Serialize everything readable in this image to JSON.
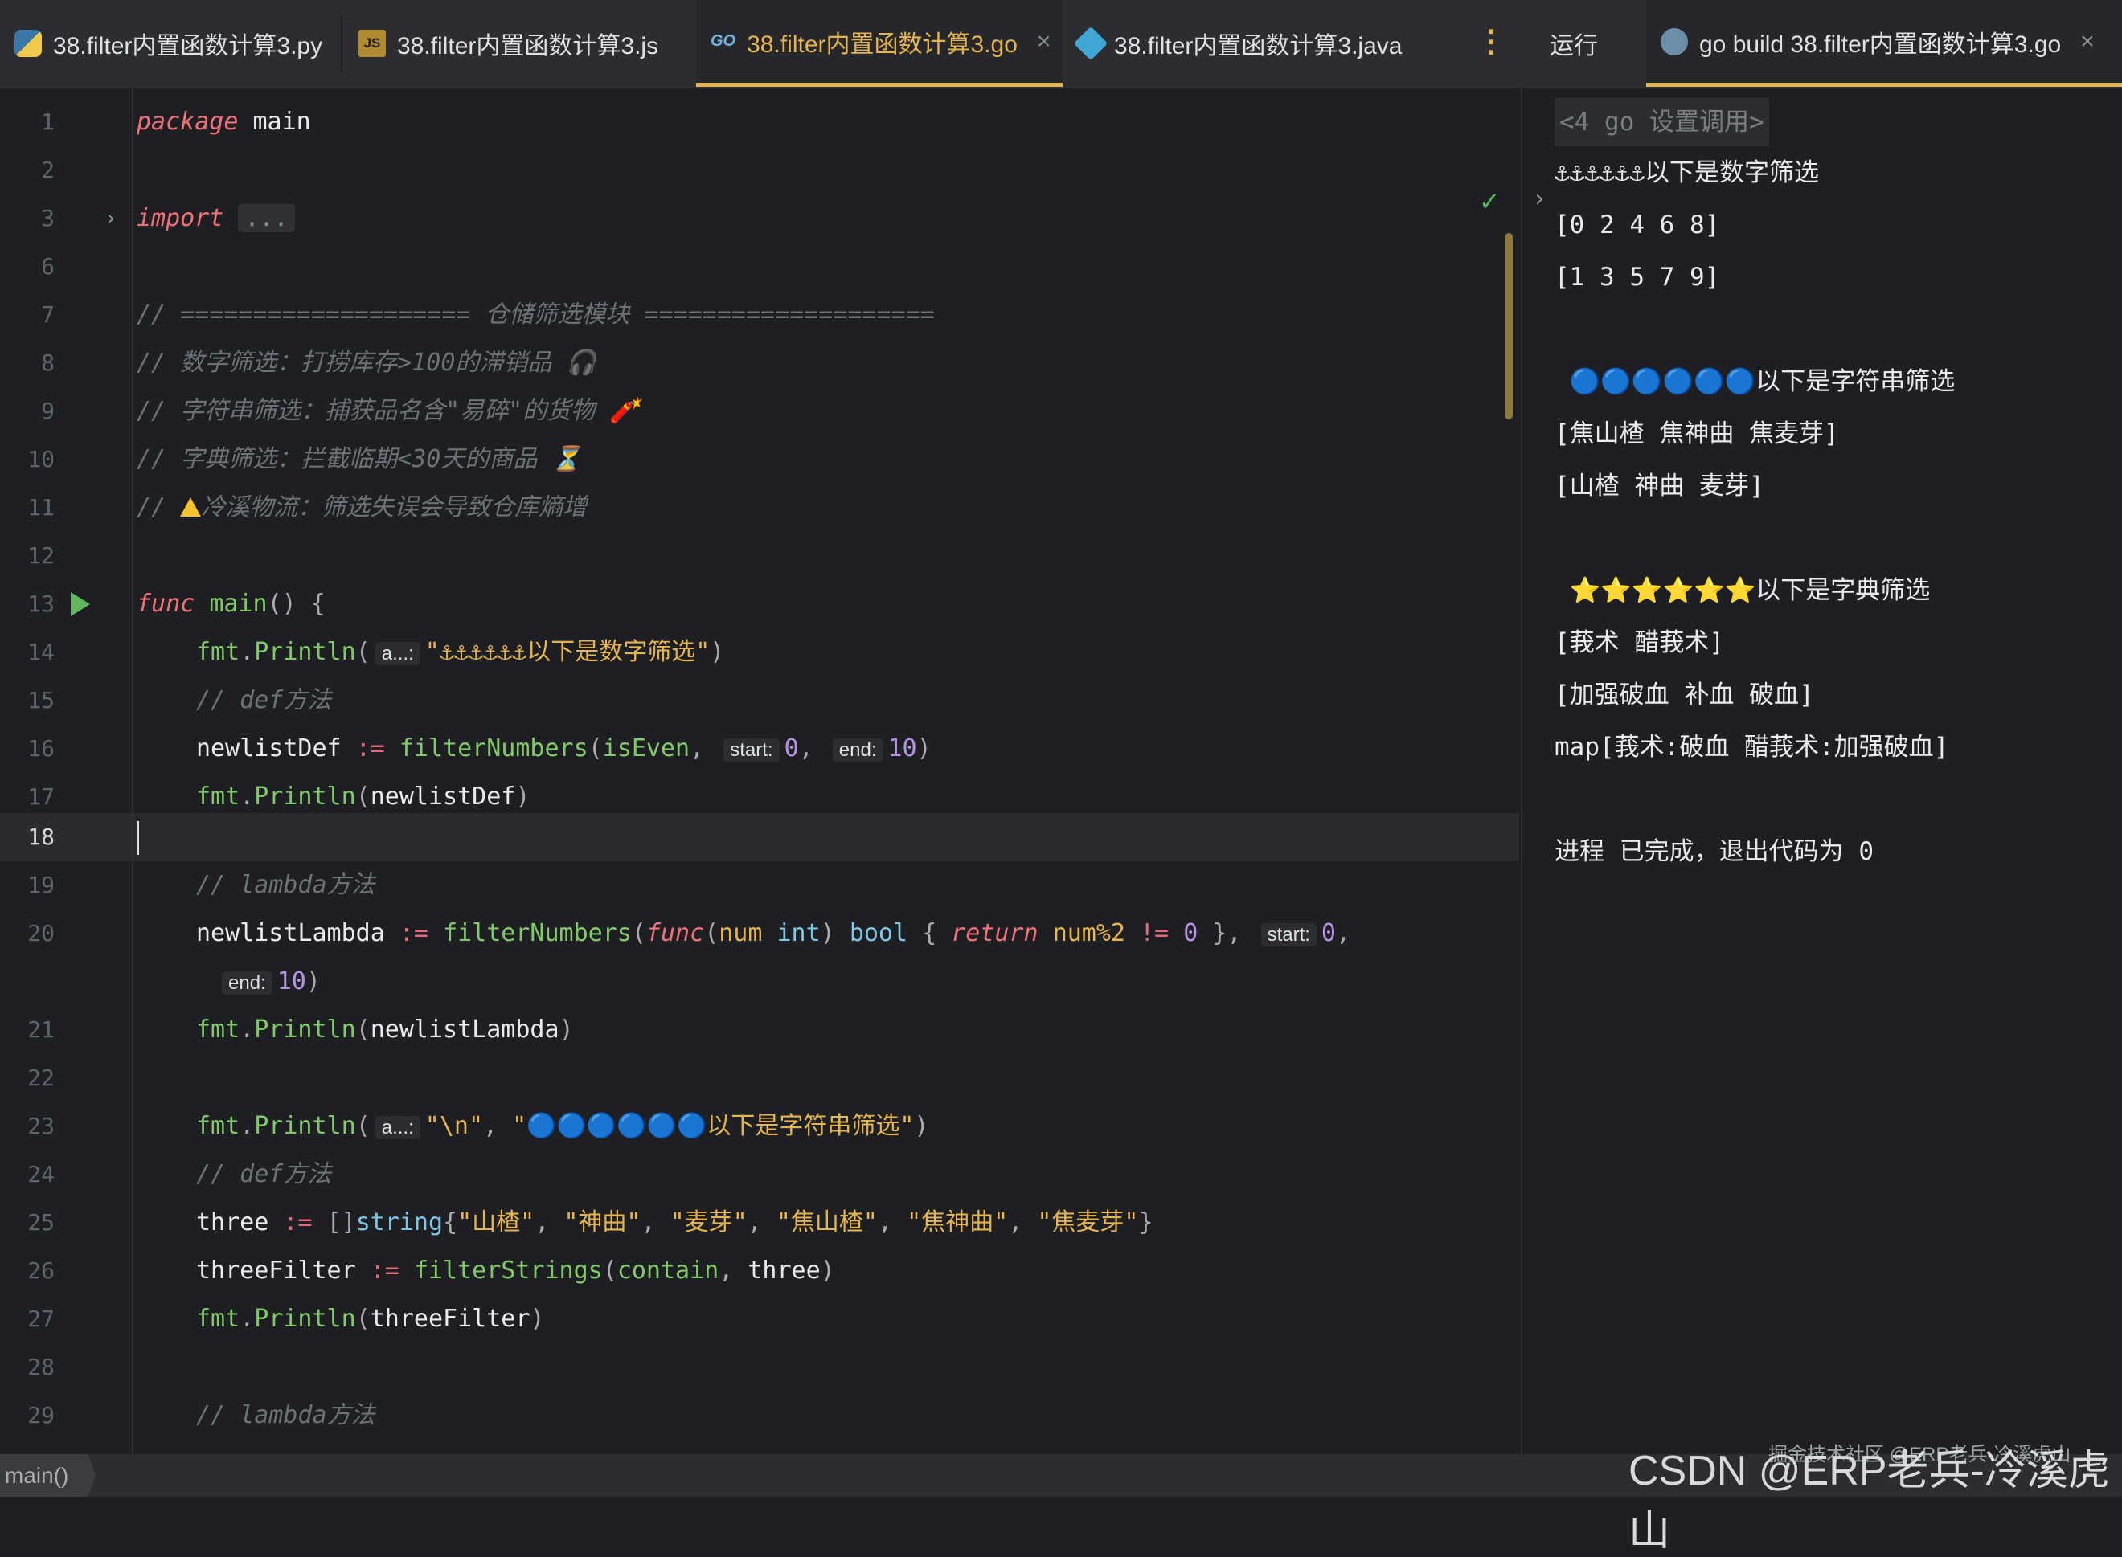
{
  "tabs": [
    {
      "label": "38.filter内置函数计算3.py",
      "icon": "python-icon"
    },
    {
      "label": "38.filter内置函数计算3.js",
      "icon": "javascript-icon",
      "icon_text": "JS"
    },
    {
      "label": "38.filter内置函数计算3.go",
      "icon": "go-icon",
      "icon_text": "GO",
      "active": true,
      "close": "×"
    },
    {
      "label": "38.filter内置函数计算3.java",
      "icon": "java-icon"
    }
  ],
  "menu_icon": "⋮",
  "run_tab": {
    "label": "运行"
  },
  "run_config_tab": {
    "label": "go build 38.filter内置函数计算3.go",
    "icon": "gopher-icon",
    "close": "×"
  },
  "editor": {
    "line_numbers": [
      "1",
      "2",
      "3",
      "6",
      "7",
      "8",
      "9",
      "10",
      "11",
      "12",
      "13",
      "14",
      "15",
      "16",
      "17",
      "18",
      "19",
      "20",
      "21",
      "22",
      "23",
      "24",
      "25",
      "26",
      "27",
      "28",
      "29"
    ],
    "kw_package": "package",
    "pkg_main": "main",
    "kw_import": "import",
    "import_fold": "...",
    "c7": "// ==================== 仓储筛选模块 ====================",
    "c8": "// 数字筛选：打捞库存>100的滞销品 🎧",
    "c9": "// 字符串筛选：捕获品名含\"易碎\"的货物 🧨",
    "c10": "// 字典筛选：拦截临期<30天的商品 ⏳",
    "c11_pre": "// ",
    "c11": "冷溪物流：筛选失误会导致仓库熵增",
    "kw_func": "func",
    "fn_main": "main",
    "main_rest": "() {",
    "fmt": "fmt",
    "println": "Println",
    "open_paren": "(",
    "close_paren": ")",
    "dot": ".",
    "hint_a": "a...:",
    "hint_start": "start:",
    "hint_end": "end:",
    "s14": "\"⚓⚓⚓⚓⚓⚓以下是数字筛选\"",
    "c15": "// def方法",
    "newlistDef": "newlistDef",
    "assign": ":=",
    "filterNumbers": "filterNumbers",
    "isEven": "isEven",
    "comma": ",",
    "n0": "0",
    "n10": "10",
    "c19": "// lambda方法",
    "newlistLambda": "newlistLambda",
    "kw_func2": "func",
    "num": "num",
    "int": "int",
    "bool": "bool",
    "lbrace": "{",
    "kw_return": "return",
    "expr": "num%2",
    "neq": "!=",
    "rbrace": "}",
    "s23a": "\"\\n\"",
    "s23b": "\"🔵🔵🔵🔵🔵🔵以下是字符串筛选\"",
    "c24": "// def方法",
    "three": "three",
    "lbrack": "[]",
    "string": "string",
    "items": [
      "\"山楂\"",
      "\"神曲\"",
      "\"麦芽\"",
      "\"焦山楂\"",
      "\"焦神曲\"",
      "\"焦麦芽\""
    ],
    "threeFilter": "threeFilter",
    "filterStrings": "filterStrings",
    "contain": "contain",
    "c29": "// lambda方法"
  },
  "output": [
    "<4 go 设置调用>",
    "⚓⚓⚓⚓⚓⚓以下是数字筛选",
    "[0 2 4 6 8]",
    "[1 3 5 7 9]",
    "",
    " 🔵🔵🔵🔵🔵🔵以下是字符串筛选",
    "[焦山楂 焦神曲 焦麦芽]",
    "[山楂 神曲 麦芽]",
    "",
    " ⭐⭐⭐⭐⭐⭐以下是字典筛选",
    "[莪术 醋莪术]",
    "[加强破血 补血 破血]",
    "map[莪术:破血 醋莪术:加强破血]",
    "",
    "进程 已完成，退出代码为 0"
  ],
  "status": {
    "breadcrumb": "main()"
  },
  "watermark": {
    "small": "掘金技术社区 @ERP老兵-冷溪虎山",
    "large": "CSDN @ERP老兵-冷溪虎山"
  },
  "colors": {
    "accent": "#e0b552",
    "keyword": "#f07178",
    "function": "#82c96b",
    "string": "#e6b450",
    "number": "#b493e6",
    "comment": "#6e7178"
  }
}
